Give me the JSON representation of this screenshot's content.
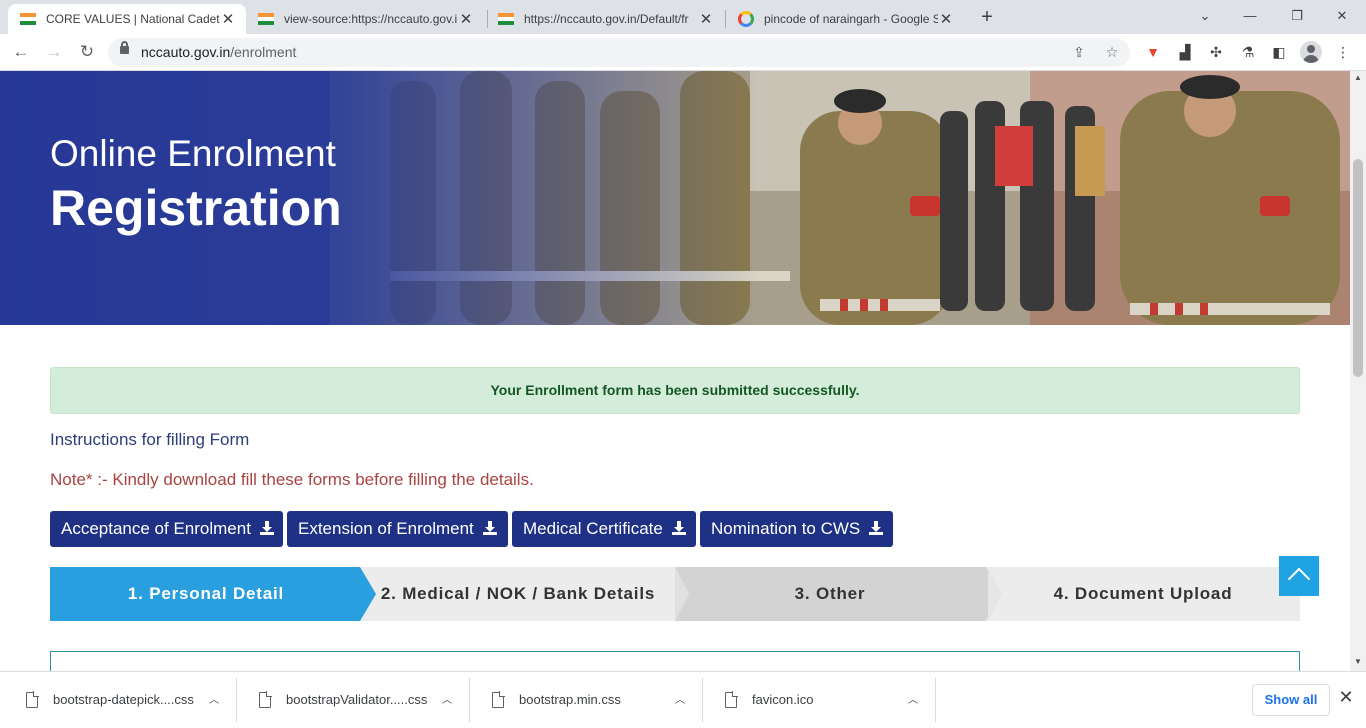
{
  "browser": {
    "tabs": [
      {
        "title": "CORE VALUES | National Cadet C",
        "favicon": "india-flag-icon"
      },
      {
        "title": "view-source:https://nccauto.gov.i",
        "favicon": "india-flag-icon"
      },
      {
        "title": "https://nccauto.gov.in/Default/fr",
        "favicon": "india-flag-icon"
      },
      {
        "title": "pincode of naraingarh - Google S",
        "favicon": "google-icon"
      }
    ],
    "active_tab_index": 0,
    "url_host": "nccauto.gov.in",
    "url_path": "/enrolment"
  },
  "hero": {
    "subtitle": "Online Enrolment",
    "title": "Registration"
  },
  "alert": {
    "message": "Your Enrollment form has been submitted successfully.",
    "color": "#d4edda"
  },
  "instructions": "Instructions for filling Form",
  "note": "Note* :- Kindly download fill these forms before filling the details.",
  "download_buttons": [
    "Acceptance of Enrolment",
    "Extension of Enrolment",
    "Medical Certificate",
    "Nomination to CWS"
  ],
  "steps": [
    {
      "label": "1. Personal Detail",
      "active": true
    },
    {
      "label": "2. Medical / NOK / Bank Details",
      "active": false
    },
    {
      "label": "3. Other",
      "active": false
    },
    {
      "label": "4. Document Upload",
      "active": false
    }
  ],
  "colors": {
    "primary": "#1e3185",
    "step_active": "#2a9fdf",
    "note": "#a94442",
    "scroll_top": "#1fa3e3"
  },
  "downloads": {
    "items": [
      "bootstrap-datepick....css",
      "bootstrapValidator.....css",
      "bootstrap.min.css",
      "favicon.ico"
    ],
    "show_all_label": "Show all"
  }
}
